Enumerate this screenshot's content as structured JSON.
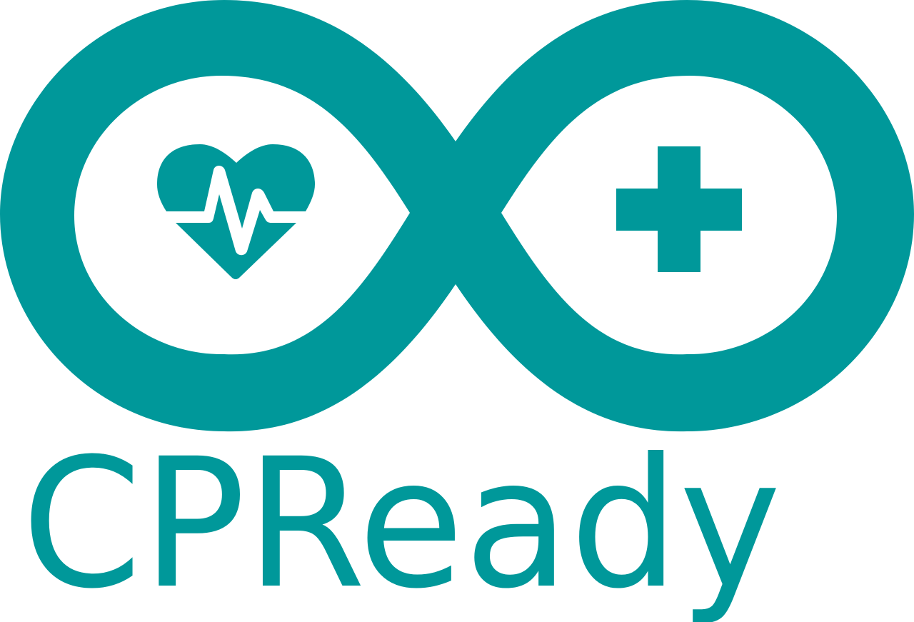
{
  "logo": {
    "wordmark": "CPReady",
    "brand_color": "#00989A",
    "background_color": "#FFFFFF",
    "left_loop_icon": "heart-pulse-icon",
    "right_loop_icon": "medical-cross-icon"
  }
}
